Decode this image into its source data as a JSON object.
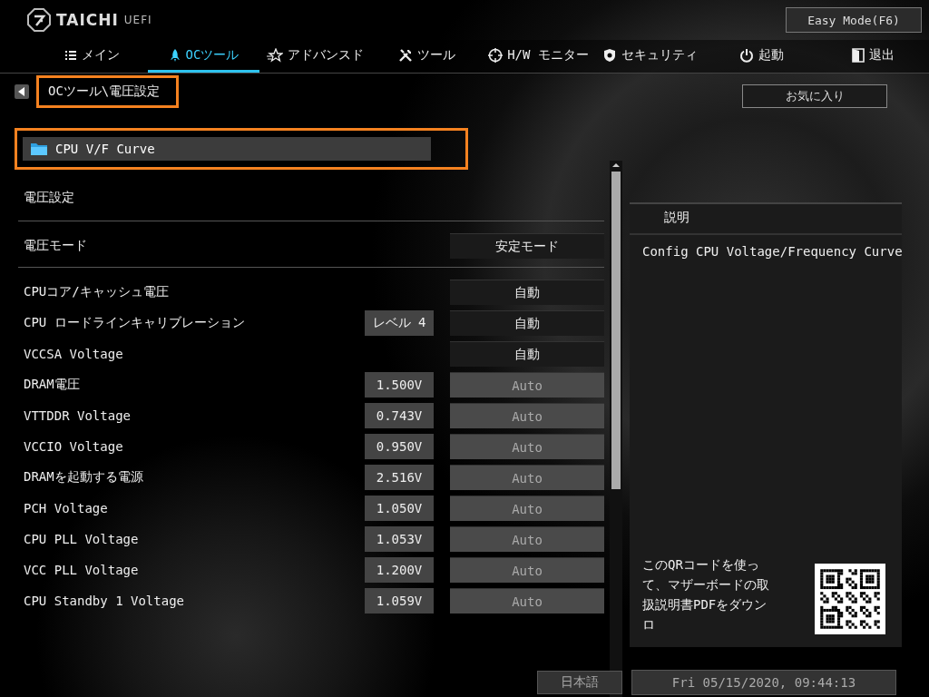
{
  "logo": {
    "brand": "TAICHI",
    "suffix": "UEFI"
  },
  "easy_mode_button": "Easy Mode(F6)",
  "tabs": [
    {
      "label": "メイン",
      "selected": false
    },
    {
      "label": "OCツール",
      "selected": true
    },
    {
      "label": "アドバンスド",
      "selected": false
    },
    {
      "label": "ツール",
      "selected": false
    },
    {
      "label": "H/W モニター",
      "selected": false
    },
    {
      "label": "セキュリティ",
      "selected": false
    },
    {
      "label": "起動",
      "selected": false
    },
    {
      "label": "退出",
      "selected": false
    }
  ],
  "breadcrumb": {
    "path": "OCツール\\電圧設定",
    "highlighted": true
  },
  "favorites_button": "お気に入り",
  "folder": {
    "label": "CPU V/F Curve",
    "highlighted": true
  },
  "section_title": "電圧設定",
  "mode_row": {
    "label": "電圧モード",
    "control": "安定モード",
    "disabled": false
  },
  "settings": [
    {
      "label": "CPUコア/キャッシュ電圧",
      "control": "自動",
      "disabled": false
    },
    {
      "label": "CPU ロードラインキャリブレーション",
      "reading": "レベル 4",
      "control": "自動",
      "disabled": false
    },
    {
      "label": "VCCSA Voltage",
      "control": "自動",
      "disabled": false
    },
    {
      "label": "DRAM電圧",
      "reading": "1.500V",
      "control": "Auto",
      "disabled": true
    },
    {
      "label": "VTTDDR Voltage",
      "reading": "0.743V",
      "control": "Auto",
      "disabled": true
    },
    {
      "label": "VCCIO Voltage",
      "reading": "0.950V",
      "control": "Auto",
      "disabled": true
    },
    {
      "label": "DRAMを起動する電源",
      "reading": "2.516V",
      "control": "Auto",
      "disabled": true
    },
    {
      "label": "PCH Voltage",
      "reading": "1.050V",
      "control": "Auto",
      "disabled": true
    },
    {
      "label": "CPU PLL Voltage",
      "reading": "1.053V",
      "control": "Auto",
      "disabled": true
    },
    {
      "label": "VCC PLL Voltage",
      "reading": "1.200V",
      "control": "Auto",
      "disabled": true
    },
    {
      "label": "CPU Standby 1 Voltage",
      "reading": "1.059V",
      "control": "Auto",
      "disabled": true
    }
  ],
  "description": {
    "title": "説明",
    "text": "Config CPU Voltage/Frequency Curve",
    "qr_text": "このQRコードを使って、マザーボードの取扱説明書PDFをダウンロ"
  },
  "footer": {
    "language": "日本語",
    "datetime": "Fri 05/15/2020, 09:44:13"
  }
}
